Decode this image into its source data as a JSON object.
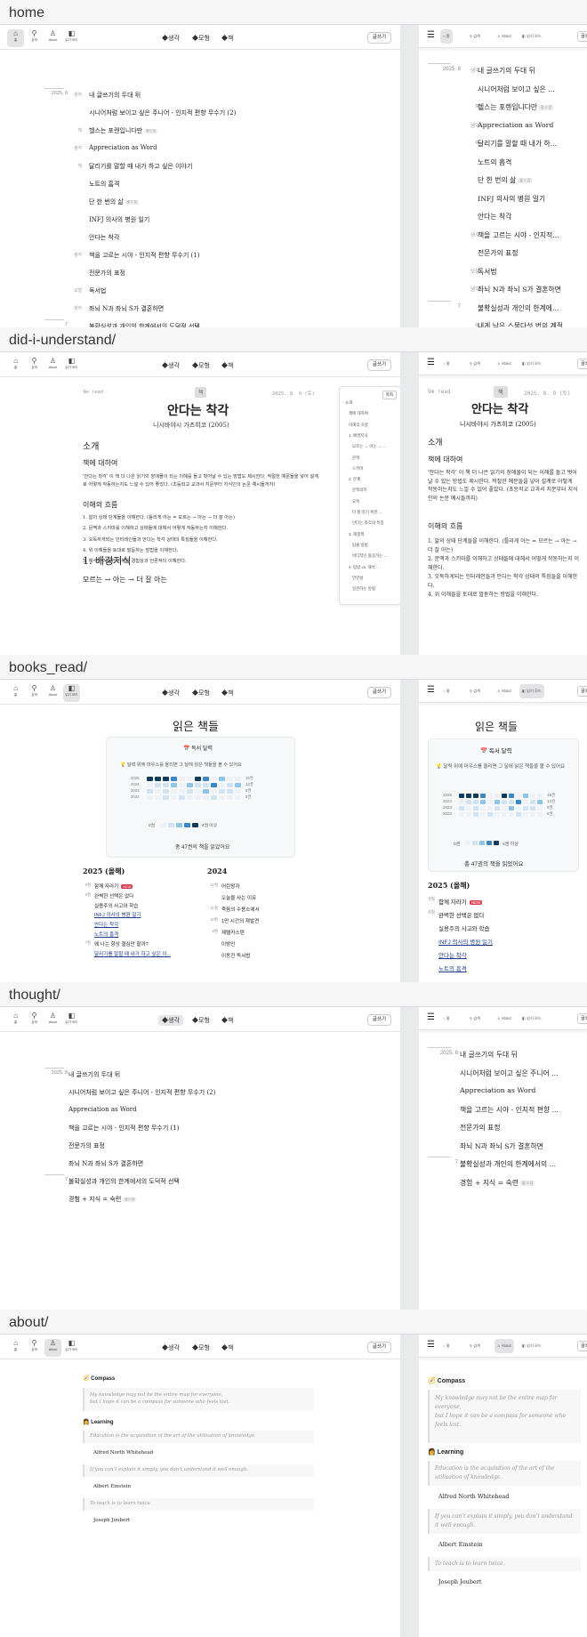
{
  "sections": {
    "home": "home",
    "diu": "did-i-understand/",
    "books": "books_read/",
    "thought": "thought/",
    "about": "about/"
  },
  "nav": {
    "home": "홈",
    "search": "검색",
    "about": "About",
    "mode": "읽기 모드",
    "t1": "생각",
    "t2": "모형",
    "t3": "책",
    "write": "글쓰기"
  },
  "mnav": {
    "home": "홈",
    "search": "검색",
    "about": "About",
    "mode": "읽기 모드",
    "write": "글쓰"
  },
  "icons": {
    "home": "home-icon",
    "search": "search-icon",
    "about": "user-icon",
    "mode": "half-circle-icon",
    "menu": "hamburger-icon",
    "tag": "tag-icon",
    "calendar": "calendar-icon",
    "bulb": "lightbulb-icon",
    "compass": "compass-icon"
  },
  "colors": {
    "heat0": "#eef1f5",
    "heat1": "#cfe3f3",
    "heat2": "#8ec4e8",
    "heat3": "#3b86c4",
    "heat4": "#0f3b5c",
    "new": "#d9394b"
  },
  "home_list": {
    "date": "2025. 8",
    "items": [
      {
        "cat": "생각",
        "title": "내 글쓰기의 두대 뒤"
      },
      {
        "cat": "",
        "title": "시니어처럼 보이고 싶은 주니어 - 인지적 편향 무수기 (2)"
      },
      {
        "cat": "책",
        "title": "헬스는 포렌입니다만",
        "badge": "줄 C 잠"
      },
      {
        "cat": "생각",
        "title": "Appreciation as Word"
      },
      {
        "cat": "책",
        "title": "달리기를 말할 때 내가 하고 싶은 이야기"
      },
      {
        "cat": "",
        "title": "노트의 흠격"
      },
      {
        "cat": "",
        "title": "단 한 번의 삶",
        "badge": "줄 C 잠"
      },
      {
        "cat": "",
        "title": "INFJ 의사의 병원 일기"
      },
      {
        "cat": "",
        "title": "안다는 착각"
      },
      {
        "cat": "생각",
        "title": "책을 고르는 시야 - 인지적 편향 무수기 (1)"
      },
      {
        "cat": "",
        "title": "전문가의 표정"
      },
      {
        "cat": "모형",
        "title": "독서법"
      },
      {
        "cat": "생각",
        "title": "좌뇌 N과 좌뇌 S가 결혼하면"
      },
      {
        "cat": "",
        "title": "불확실성과 개인의 한계에서의 도덕적 선택",
        "month": "7"
      },
      {
        "cat": "책",
        "title": "내게 남은 스물다섯 번의 계절",
        "badge": "줄 C 잠"
      }
    ],
    "m_items": [
      {
        "cat": "생각",
        "title": "내 글쓰기의 두대 뒤"
      },
      {
        "cat": "",
        "title": "시니어처럼 보이고 싶은 ..."
      },
      {
        "cat": "책",
        "title": "헬스는 포렌입니다만",
        "badge": "줄 C 잠"
      },
      {
        "cat": "생각",
        "title": "Appreciation as Word"
      },
      {
        "cat": "책",
        "title": "달리기를 말할 때 내가 하..."
      },
      {
        "cat": "",
        "title": "노트의 흠격"
      },
      {
        "cat": "",
        "title": "단 한 번의 삶",
        "badge": "줄 C 잠"
      },
      {
        "cat": "",
        "title": "INFJ 의사의 병원 일기"
      },
      {
        "cat": "",
        "title": "안다는 착각"
      },
      {
        "cat": "생각",
        "title": "책을 고르는 시야 - 인지적..."
      },
      {
        "cat": "",
        "title": "전문가의 표정"
      },
      {
        "cat": "모형",
        "title": "독서법"
      },
      {
        "cat": "생각",
        "title": "좌뇌 N과 좌뇌 S가 결혼하면"
      },
      {
        "cat": "",
        "title": "불확실성과 개인의 한계에...",
        "month": "7"
      },
      {
        "cat": "책",
        "title": "내게 남은 스물다섯 번의 계절"
      }
    ]
  },
  "article": {
    "readtime": "9m read",
    "tag": "책",
    "date": "2025. 8. 9 (토)",
    "title": "안다는 착각",
    "subtitle": "니시바야시 가츠히코 (2005)",
    "h_intro": "소개",
    "h_about": "책에 대하여",
    "p_about": "'안다는 착각' 이 책 더 나은 읽기의 장애물이 되는 이해를 돌고 벗어날 수 있는 방법도 제시한다. 적절한 예문들을 넣어 설계로 어떻게 작동하는지도 느낄 수 있어 좋았다. (초등학교 교과서 지문부터 지식인의 논문 예시들까지)",
    "h_flow": "이해의 흐름",
    "flow": [
      "1. 앎의 상태 단계들을 이해한다. (틀리게 아는 = 모르는 → 아는 → 더 잘 아는)",
      "2. 문맥과 스키마를 이해하고 상태들에 대해서 어떻게 작동하는지 이해한다.",
      "3. 오독하게되는 인터레인들과 안다는 착각 상태의 특징들을 이해한다.",
      "4. 위 이해들을 토대로 발돋하는 방법을 이해한다.",
      "5. 해석이 가능한 범위를 경험상과 언론적이 이해한다."
    ],
    "m_flow": [
      "1. 앎의 상태 단계들을 이해한다. (틀리게 아는 = 모르는 → 아는 → 더 잘 아는)",
      "2. 문맥과 스키마를 이해하고 상태들에 대해서 어떻게 작동하는지 이해한다.",
      "3. 오독하게되는 인터레인들과 안다는 착각 상태의 특징들을 이해한다.",
      "4. 위 이해들을 토대로 발돋하는 방법을 이해한다."
    ],
    "h1": "1. 배경지식",
    "p1": "모르는 → 아는 → 더 잘 아는",
    "toc_btn": "목차",
    "toc": [
      "소개",
      "책에 대하여",
      "이해의 흐름",
      "1. 배경지식",
      "모르는 → 아는 → ...",
      "문맥",
      "스키마",
      "2. 문제",
      "문맥의지",
      "오독",
      "더 잘 알기 위한 ...",
      "안다는 착각의 특징",
      "3. 해결책",
      "탐출 방법",
      "바디적인 좁음하는 ...",
      "4. 탐방 vs. 해석 ...",
      "언한성",
      "일관하는 방법"
    ]
  },
  "books": {
    "title": "읽은 책들",
    "cal_title": "독서 달력",
    "hint": "달력 위에 마우스를 올리면 그 달에 읽은 책들을 볼 수 있어요",
    "years": [
      "2025",
      "2024",
      "2023",
      "2022"
    ],
    "counts": [
      "19권",
      "13권",
      "9권",
      "6권"
    ],
    "heat": [
      [
        4,
        4,
        4,
        3,
        0,
        0,
        4,
        3,
        0,
        2,
        0,
        0
      ],
      [
        0,
        1,
        1,
        2,
        0,
        2,
        1,
        1,
        3,
        0,
        1,
        2
      ],
      [
        1,
        0,
        1,
        0,
        0,
        1,
        0,
        2,
        0,
        1,
        1,
        0
      ],
      [
        0,
        0,
        1,
        0,
        1,
        0,
        0,
        0,
        1,
        0,
        0,
        0
      ]
    ],
    "legend_lo": "0권",
    "legend_hi": "4권 이상",
    "total": "총 47권의 책을 읽었어요",
    "y25": "2025 (올해)",
    "y24": "2024",
    "list25": [
      {
        "m": "9월",
        "t": "함께 자라기",
        "new": "NEW"
      },
      {
        "m": "8월",
        "t": "완벽한 선택은 없다"
      },
      {
        "m": "",
        "t": "실용주의 사고와 학습"
      },
      {
        "m": "",
        "t": "INFJ 의사의 병원 일기",
        "lnk": true
      },
      {
        "m": "",
        "t": "안다는 착각",
        "lnk": true
      },
      {
        "m": "",
        "t": "노트의 흠격",
        "lnk": true
      },
      {
        "m": "7월",
        "t": "왜 나는 항상 결심만 할까?"
      },
      {
        "m": "",
        "t": "달리기를 말할 때 내가 하고 싶은 이...",
        "lnk": true
      }
    ],
    "m_list25": [
      {
        "m": "9월",
        "t": "함께 자라기",
        "new": "NEW"
      },
      {
        "m": "8월",
        "t": "완벽한 선택은 없다"
      },
      {
        "m": "",
        "t": "실용주의 사고와 학습"
      },
      {
        "m": "",
        "t": "INFJ 의사의 병원 일기",
        "lnk": true
      },
      {
        "m": "",
        "t": "안다는 착각",
        "lnk": true
      },
      {
        "m": "",
        "t": "노트의 흠격",
        "lnk": true
      }
    ],
    "list24": [
      {
        "m": "12월",
        "t": "어린왕자"
      },
      {
        "m": "",
        "t": "오늘을 사는 이유"
      },
      {
        "m": "11월",
        "t": "죽음의 수용소에서"
      },
      {
        "m": "10월",
        "t": "1만 시간의 재발견"
      },
      {
        "m": "9월",
        "t": "제텔카스텐"
      },
      {
        "m": "",
        "t": "이방인"
      },
      {
        "m": "",
        "t": "이동진 독서법"
      }
    ]
  },
  "thought_list": {
    "date": "2025. 8",
    "items": [
      {
        "title": "내 글쓰기의 두대 뒤"
      },
      {
        "title": "시니어처럼 보이고 싶은 주니어 - 인지적 편향 무수기 (2)"
      },
      {
        "title": "Appreciation as Word"
      },
      {
        "title": "책을 고르는 시야 - 인지적 편향 무수기 (1)"
      },
      {
        "title": "전문가의 표정"
      },
      {
        "title": "좌뇌 N과 좌뇌 S가 결혼하면"
      },
      {
        "title": "불확실성과 개인의 한계에서의 도덕적 선택",
        "month": "7"
      },
      {
        "title": "경험 + 지식 = 숙련",
        "badge": "줄 C 잠"
      }
    ],
    "m_items": [
      {
        "title": "내 글쓰기의 두대 뒤"
      },
      {
        "title": "시니어처럼 보이고 싶은 주니어 ..."
      },
      {
        "title": "Appreciation as Word"
      },
      {
        "title": "책을 고르는 시야 - 인지적 편향 ..."
      },
      {
        "title": "전문가의 표정"
      },
      {
        "title": "좌뇌 N과 좌뇌 S가 결혼하면"
      },
      {
        "title": "불확실성과 개인의 한계에서의 ...",
        "month": "7"
      },
      {
        "title": "경험 + 지식 = 숙련",
        "badge": "줄 C 잠"
      }
    ]
  },
  "about": {
    "compass": "Compass",
    "q1": "My knowledge may not be the entire map for everyone,",
    "q1b": "but I hope it can be a compass for someone who feels lost.",
    "learning": "Learning",
    "q2": "Education is the acquisition of the art of the utilisation of knowledge.",
    "a2": "Alfred North Whitehead",
    "q3": "If you can’t explain it simply, you don’t understand it well enough.",
    "a3": "Albert Einstein",
    "q4": "To teach is to learn twice.",
    "a4": "Joseph Joubert"
  }
}
